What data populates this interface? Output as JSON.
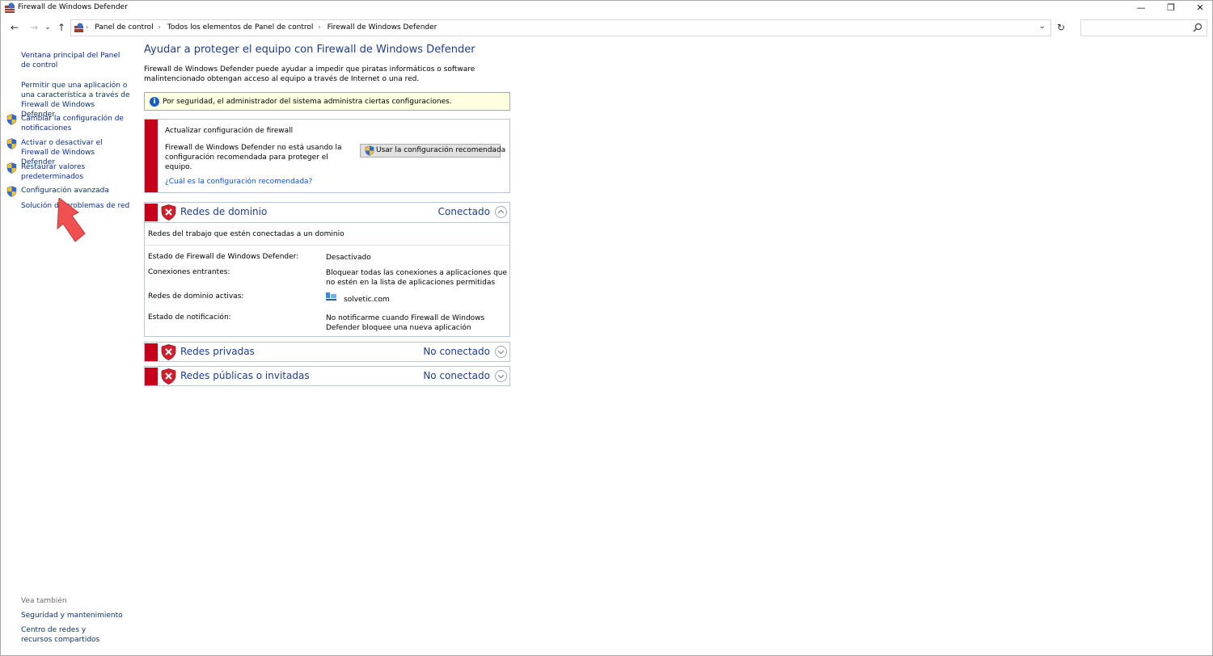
{
  "window": {
    "title": "Firewall de Windows Defender",
    "minimize": "—",
    "restore": "❐",
    "close": "✕"
  },
  "nav": {
    "back": "←",
    "forward": "→",
    "recent": "⌄",
    "up": "↑",
    "breadcrumbs": [
      "Panel de control",
      "Todos los elementos de Panel de control",
      "Firewall de Windows Defender"
    ],
    "dropdown": "⌄",
    "refresh": "↻",
    "search_placeholder": ""
  },
  "sidebar": {
    "items": [
      {
        "label": "Ventana principal del Panel de control",
        "shield": false
      },
      {
        "label": "Permitir que una aplicación o una característica a través de Firewall de Windows Defender",
        "shield": false
      },
      {
        "label": "Cambiar la configuración de notificaciones",
        "shield": true
      },
      {
        "label": "Activar o desactivar el Firewall de Windows Defender",
        "shield": true
      },
      {
        "label": "Restaurar valores predeterminados",
        "shield": true
      },
      {
        "label": "Configuración avanzada",
        "shield": true
      },
      {
        "label": "Solución de problemas de red",
        "shield": false
      }
    ],
    "see_also_title": "Vea también",
    "see_also": [
      {
        "label": "Seguridad y mantenimiento"
      },
      {
        "label": "Centro de redes y recursos compartidos"
      }
    ]
  },
  "main": {
    "title": "Ayudar a proteger el equipo con Firewall de Windows Defender",
    "intro": "Firewall de Windows Defender puede ayudar a impedir que piratas informáticos o software malintencionado obtengan acceso al equipo a través de Internet o una red.",
    "info_text": "Por seguridad, el administrador del sistema administra ciertas configuraciones.",
    "update": {
      "title": "Actualizar configuración de firewall",
      "description": "Firewall de Windows Defender no está usando la configuración recomendada para proteger el equipo.",
      "link": "¿Cuál es la configuración recomendada?",
      "button": "Usar la configuración recomendada"
    },
    "networks": [
      {
        "name": "Redes de dominio",
        "status": "Conectado",
        "expanded": true,
        "subtitle": "Redes del trabajo que estén conectadas a un dominio",
        "details": [
          {
            "label": "Estado de Firewall de Windows Defender:",
            "value": "Desactivado"
          },
          {
            "label": "Conexiones entrantes:",
            "value": "Bloquear todas las conexiones a aplicaciones que no estén en la lista de aplicaciones permitidas"
          },
          {
            "label": "Redes de dominio activas:",
            "value": "solvetic.com"
          },
          {
            "label": "Estado de notificación:",
            "value": "No notificarme cuando Firewall de Windows Defender bloquee una nueva aplicación"
          }
        ]
      },
      {
        "name": "Redes privadas",
        "status": "No conectado",
        "expanded": false
      },
      {
        "name": "Redes públicas o invitadas",
        "status": "No conectado",
        "expanded": false
      }
    ]
  },
  "colors": {
    "link": "#0a2e86",
    "heading": "#1e3d8c",
    "alert_red": "#c8001c",
    "info_bg": "#ffffe1",
    "annotation_arrow": "#f0504f"
  }
}
